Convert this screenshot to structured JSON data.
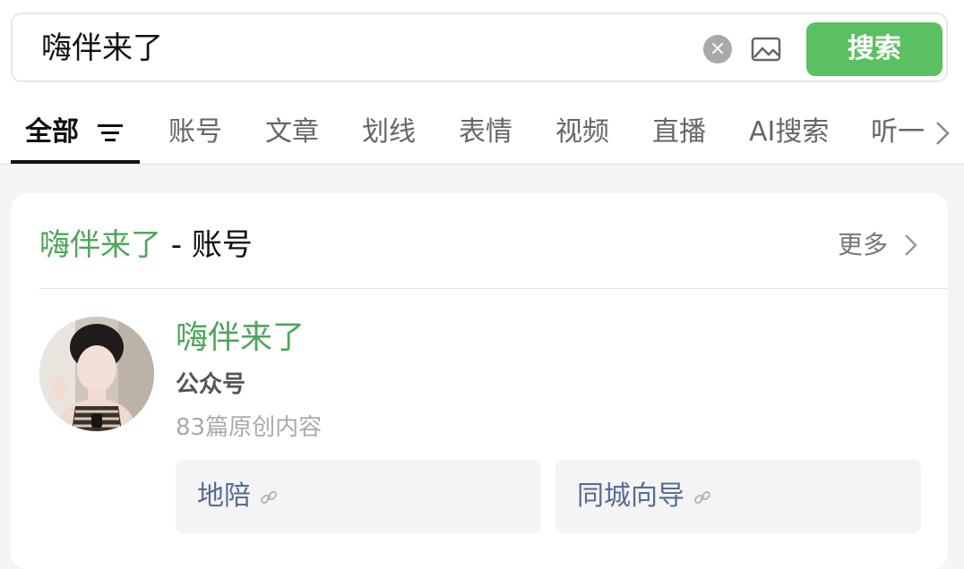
{
  "search": {
    "query": "嗨伴来了",
    "button_label": "搜索",
    "clear_icon": "close-circle-icon",
    "image_icon": "image-icon"
  },
  "tabs": [
    {
      "label": "全部",
      "active": true
    },
    {
      "label": "账号"
    },
    {
      "label": "文章"
    },
    {
      "label": "划线"
    },
    {
      "label": "表情"
    },
    {
      "label": "视频"
    },
    {
      "label": "直播"
    },
    {
      "label": "AI搜索"
    },
    {
      "label": "听一"
    }
  ],
  "account_section": {
    "title_highlight": "嗨伴来了",
    "title_rest": " - 账号",
    "more_label": "更多",
    "account": {
      "name": "嗨伴来了",
      "type": "公众号",
      "count_text": "83篇原创内容"
    },
    "links": [
      {
        "label": "地陪"
      },
      {
        "label": "同城向导"
      }
    ]
  },
  "colors": {
    "accent_green": "#5ac061",
    "highlight_green": "#4fa65a",
    "link_blue": "#576b95"
  }
}
